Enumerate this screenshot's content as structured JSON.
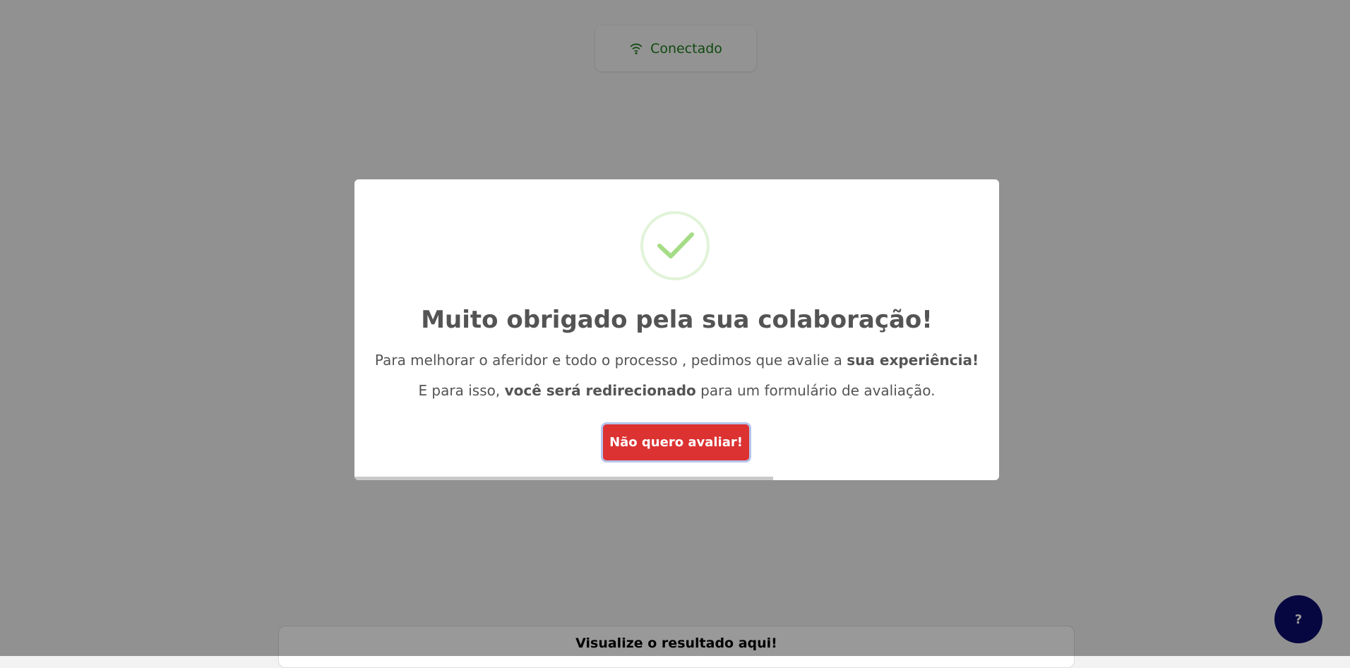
{
  "status": {
    "label": "Conectado",
    "icon": "wifi-icon",
    "color": "#1b7a1b"
  },
  "result_bar": {
    "label": "Visualize o resultado aqui!"
  },
  "help_button": {
    "label": "?",
    "color": "#0b0b6b"
  },
  "modal": {
    "icon": "checkmark-icon",
    "title": "Muito obrigado pela sua colaboração!",
    "line1_text": "Para melhorar o aferidor e todo o processo , pedimos que avalie a ",
    "line1_bold": "sua experiência!",
    "line2_prefix": "E para isso, ",
    "line2_bold": "você será redirecionado",
    "line2_suffix": " para um formulário de avaliação.",
    "decline_button": "Não quero avaliar!",
    "decline_color": "#dc3232",
    "timer_progress": 0.65
  }
}
